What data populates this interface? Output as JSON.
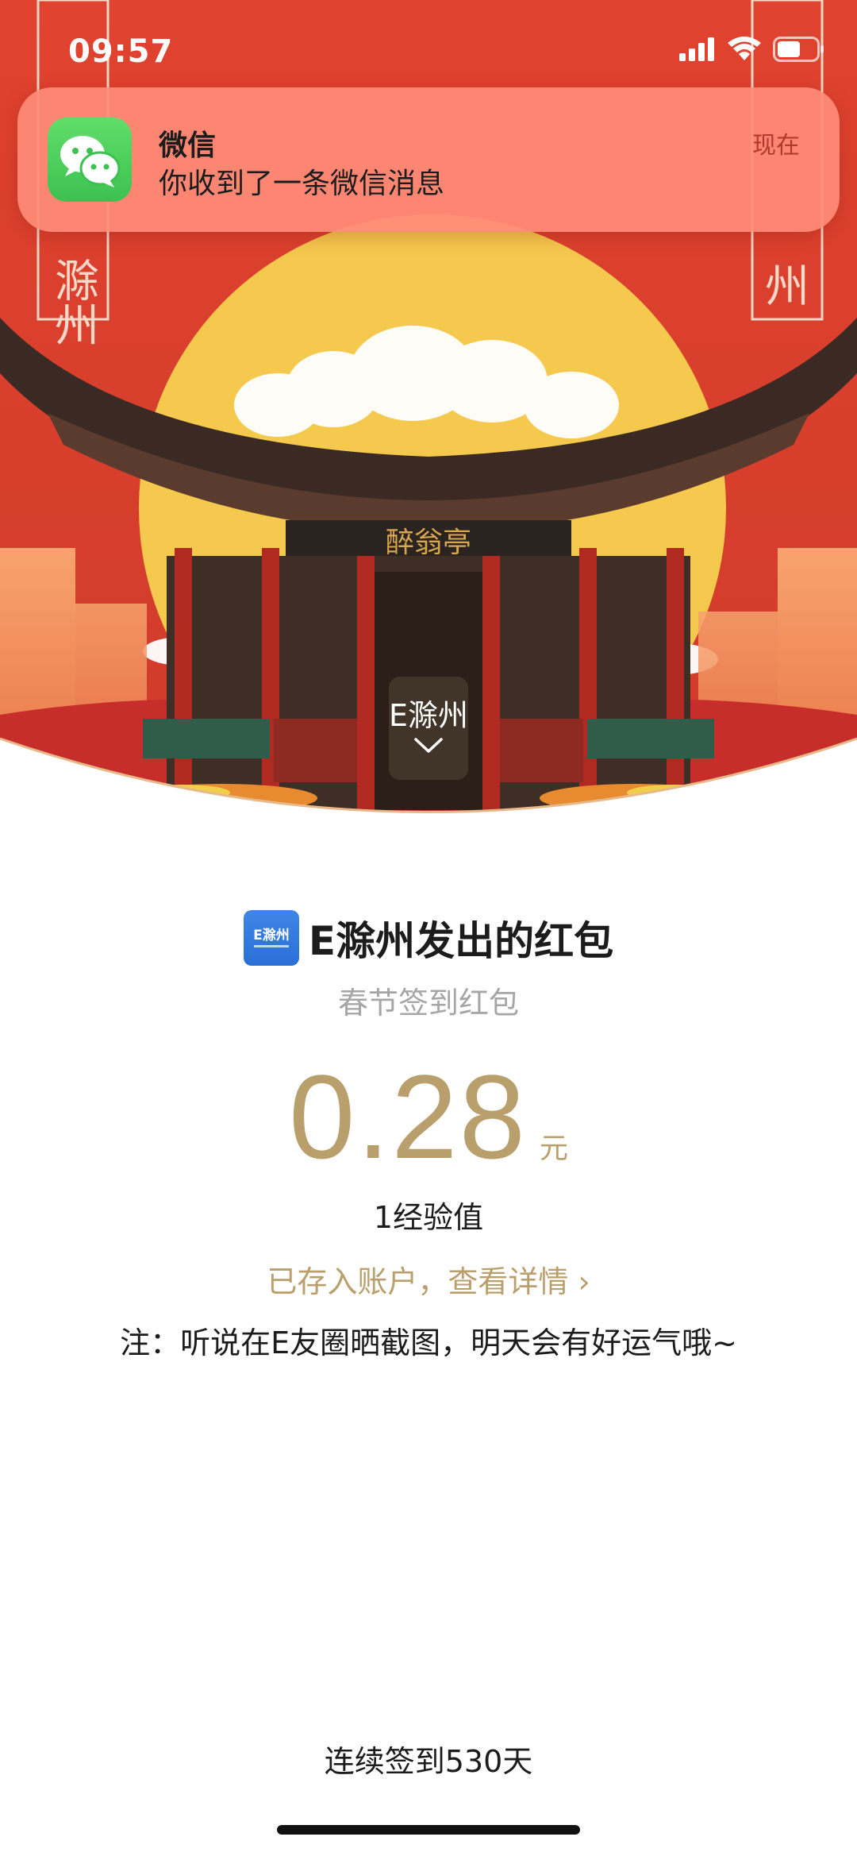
{
  "status_bar": {
    "time": "09:57"
  },
  "notification": {
    "app_name": "微信",
    "message": "你收到了一条微信消息",
    "time": "现在",
    "app_icon": "wechat-icon"
  },
  "banner": {
    "city_selector": "E滁州",
    "pavilion_plaque": "醉翁亭",
    "left_scroll_text": "滁州",
    "right_scroll_text": "州"
  },
  "red_packet": {
    "sender": "E滁州发出的红包",
    "sender_logo_text": "E滁州",
    "subtitle": "春节签到红包",
    "amount": "0.28",
    "unit": "元",
    "experience": "1经验值",
    "details_link": "已存入账户，查看详情 ›",
    "note": "注：听说在E友圈晒截图，明天会有好运气哦~",
    "streak": "连续签到530天"
  },
  "colors": {
    "banner_red": "#d9402f",
    "sun_yellow": "#f5c84e",
    "gold_text": "#b99f6c",
    "notification_bg": "#ff8c78"
  }
}
